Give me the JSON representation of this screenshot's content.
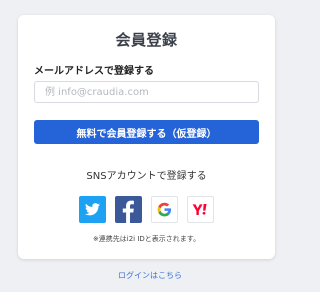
{
  "title": "会員登録",
  "email": {
    "label": "メールアドレスで登録する",
    "placeholder": "例 info@craudia.com",
    "value": ""
  },
  "submit": {
    "label": "無料で会員登録する（仮登録）"
  },
  "sns": {
    "label": "SNSアカウントで登録する",
    "buttons": [
      {
        "name": "twitter",
        "icon": "twitter-icon",
        "color": "#1da1f2"
      },
      {
        "name": "facebook",
        "icon": "facebook-icon",
        "color": "#3b5998"
      },
      {
        "name": "google",
        "icon": "google-icon",
        "color": "#4285f4"
      },
      {
        "name": "yahoo",
        "icon": "yahoo-icon",
        "color": "#ff0033"
      }
    ]
  },
  "note": "※連携先はi2i IDと表示されます。",
  "login_link": "ログインはこちら",
  "colors": {
    "accent": "#2563d8",
    "link": "#3d74d6",
    "background": "#eef0f3"
  }
}
